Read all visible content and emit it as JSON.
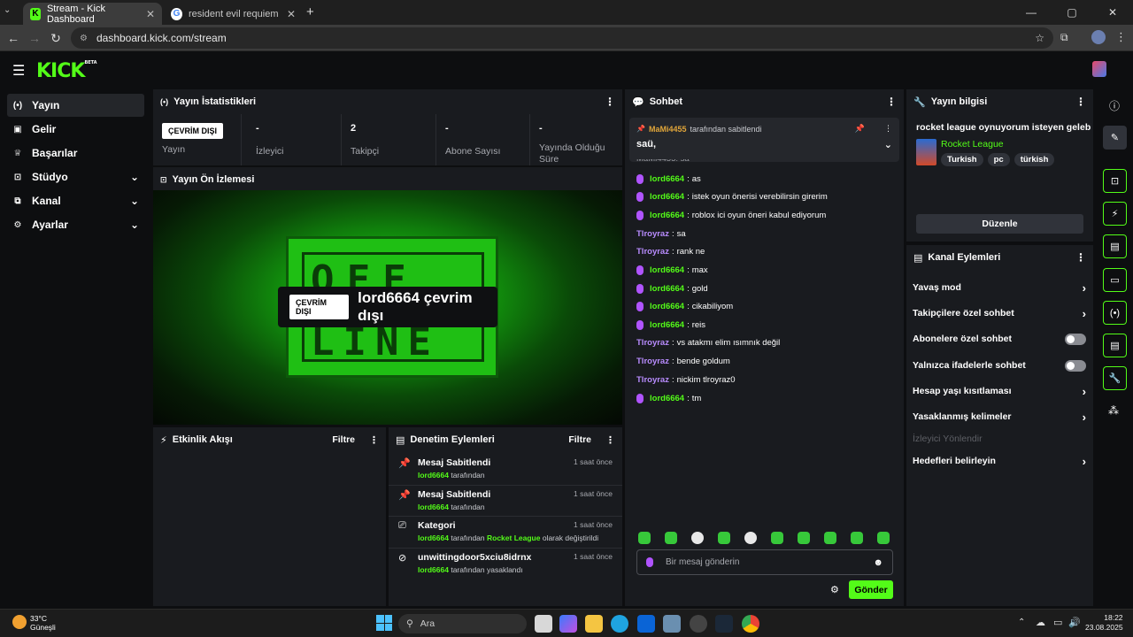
{
  "browser": {
    "tabs": [
      {
        "title": "Stream - Kick Dashboard",
        "active": true
      },
      {
        "title": "resident evil requiem - Google'",
        "active": false
      }
    ],
    "new_tab": "+",
    "url": "dashboard.kick.com/stream",
    "window_controls": [
      "—",
      "▢",
      "✕"
    ]
  },
  "kick": {
    "logo": "KICK",
    "logo_sup": "BETA"
  },
  "sidebar": {
    "items": [
      {
        "label": "Yayın",
        "icon": "broadcast-icon",
        "active": true
      },
      {
        "label": "Gelir",
        "icon": "wallet-icon"
      },
      {
        "label": "Başarılar",
        "icon": "trophy-icon"
      },
      {
        "label": "Stüdyo",
        "icon": "studio-icon",
        "chevron": true
      },
      {
        "label": "Kanal",
        "icon": "channel-icon",
        "chevron": true
      },
      {
        "label": "Ayarlar",
        "icon": "gear-icon",
        "chevron": true
      }
    ]
  },
  "stats": {
    "title": "Yayın İstatistikleri",
    "status_badge": "ÇEVRİM DIŞI",
    "cells": [
      {
        "value": "",
        "label": "Yayın"
      },
      {
        "value": "-",
        "label": "İzleyici"
      },
      {
        "value": "2",
        "label": "Takipçi"
      },
      {
        "value": "-",
        "label": "Abone Sayısı"
      },
      {
        "value": "-",
        "label": "Yayında Olduğu Süre"
      }
    ]
  },
  "preview": {
    "title": "Yayın Ön İzlemesi",
    "badge": "ÇEVRİM DIŞI",
    "text": "lord6664 çevrim dışı",
    "sign_top": "OFF",
    "sign_bottom": "LINE"
  },
  "activity": {
    "title": "Etkinlik Akışı",
    "filter": "Filtre"
  },
  "moderation": {
    "title": "Denetim Eylemleri",
    "filter": "Filtre",
    "items": [
      {
        "icon": "pin-icon",
        "title": "Mesaj Sabitlendi",
        "time": "1 saat önce",
        "user": "lord6664",
        "rest": "tarafından",
        "extra": "",
        "tail": ""
      },
      {
        "icon": "pin-icon",
        "title": "Mesaj Sabitlendi",
        "time": "1 saat önce",
        "user": "lord6664",
        "rest": "tarafından",
        "extra": "",
        "tail": ""
      },
      {
        "icon": "category-icon",
        "title": "Kategori",
        "time": "1 saat önce",
        "user": "lord6664",
        "rest": "tarafından",
        "extra": "Rocket League",
        "tail": "olarak değiştirildi"
      },
      {
        "icon": "ban-icon",
        "title": "unwittingdoor5xciu8idrnx",
        "time": "1 saat önce",
        "user": "lord6664",
        "rest": "tarafından yasaklandı",
        "extra": "",
        "tail": ""
      }
    ]
  },
  "chat": {
    "title": "Sohbet",
    "pinned": {
      "user": "MaMi4455",
      "by": "tarafından sabitlendi",
      "message": "saü,"
    },
    "partial_line": "MaMi4455: sa",
    "messages": [
      {
        "user": "lord6664",
        "text": "as",
        "mod": true
      },
      {
        "user": "lord6664",
        "text": "istek oyun önerisi verebilirsin girerim",
        "mod": true
      },
      {
        "user": "lord6664",
        "text": "roblox ici oyun öneri kabul ediyorum",
        "mod": true
      },
      {
        "user": "Tlroyraz",
        "text": "sa",
        "mod": false
      },
      {
        "user": "Tlroyraz",
        "text": "rank ne",
        "mod": false
      },
      {
        "user": "lord6664",
        "text": "max",
        "mod": true
      },
      {
        "user": "lord6664",
        "text": "gold",
        "mod": true
      },
      {
        "user": "lord6664",
        "text": "cikabiliyom",
        "mod": true
      },
      {
        "user": "lord6664",
        "text": "reis",
        "mod": true
      },
      {
        "user": "Tlroyraz",
        "text": "vs atakmı elim ısımnık değil",
        "mod": false
      },
      {
        "user": "Tlroyraz",
        "text": "bende goldum",
        "mod": false
      },
      {
        "user": "Tlroyraz",
        "text": "nickim tlroyraz0",
        "mod": false
      },
      {
        "user": "lord6664",
        "text": "tm",
        "mod": true
      }
    ],
    "input_placeholder": "Bir mesaj gönderin",
    "send_label": "Gönder"
  },
  "stream_info": {
    "title": "Yayın bilgisi",
    "stream_title": "rocket league oynuyorum isteyen gelebilir",
    "category": "Rocket League",
    "tags": [
      "Turkish",
      "pc",
      "türkish"
    ],
    "edit_label": "Düzenle"
  },
  "channel_actions": {
    "title": "Kanal Eylemleri",
    "items": [
      {
        "label": "Yavaş mod",
        "type": "chevron"
      },
      {
        "label": "Takipçilere özel sohbet",
        "type": "chevron"
      },
      {
        "label": "Abonelere özel sohbet",
        "type": "toggle"
      },
      {
        "label": "Yalnızca ifadelerle sohbet",
        "type": "toggle"
      },
      {
        "label": "Hesap yaşı kısıtlaması",
        "type": "chevron"
      },
      {
        "label": "Yasaklanmış kelimeler",
        "type": "chevron"
      },
      {
        "label": "İzleyici Yönlendir",
        "type": "disabled"
      },
      {
        "label": "Hedefleri belirleyin",
        "type": "chevron"
      }
    ]
  },
  "taskbar": {
    "weather_temp": "33°C",
    "weather_desc": "Güneşli",
    "search": "Ara",
    "time": "18:22",
    "date": "23.08.2025"
  },
  "colors": {
    "accent": "#53fc18",
    "panel": "#191b1f",
    "bg": "#0d0e10"
  }
}
